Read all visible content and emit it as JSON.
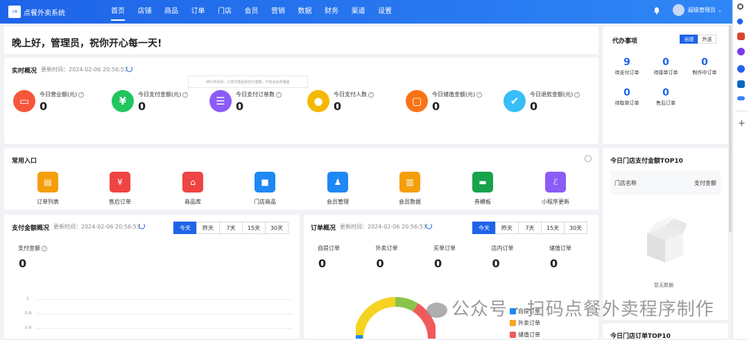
{
  "app": {
    "logo_mini": "点餐",
    "title": "点餐外卖系统"
  },
  "nav": [
    {
      "label": "首页",
      "active": true
    },
    {
      "label": "店铺"
    },
    {
      "label": "商品"
    },
    {
      "label": "订单"
    },
    {
      "label": "门店"
    },
    {
      "label": "会员"
    },
    {
      "label": "营销"
    },
    {
      "label": "数据"
    },
    {
      "label": "财务"
    },
    {
      "label": "渠道"
    },
    {
      "label": "设置"
    }
  ],
  "user": {
    "name": "超级管理员"
  },
  "greeting": "晚上好，管理员，祝你开心每一天!",
  "realtime": {
    "title": "实时概况",
    "updated": "更新时间：2024-02-06 20:56:53",
    "tooltip": "统计时间内，订单优惠后的实付金额，不包含会员储值",
    "stats": [
      {
        "label": "今日营业额(元)",
        "value": "0",
        "color": "#f5573b",
        "icon": "shop-icon",
        "glyph": "▭"
      },
      {
        "label": "今日支付金额(元)",
        "value": "0",
        "color": "#22c55e",
        "icon": "yen-icon",
        "glyph": "¥"
      },
      {
        "label": "今日支付订单数",
        "value": "0",
        "color": "#8b5cf6",
        "icon": "list-icon",
        "glyph": "☰"
      },
      {
        "label": "今日支付人数",
        "value": "0",
        "color": "#f5b800",
        "icon": "person-icon",
        "glyph": "●"
      },
      {
        "label": "今日储值金额(元)",
        "value": "0",
        "color": "#f97316",
        "icon": "wallet-icon",
        "glyph": "▢"
      },
      {
        "label": "今日退款金额(元)",
        "value": "0",
        "color": "#38bdf8",
        "icon": "shield-icon",
        "glyph": "✔"
      }
    ]
  },
  "entries": {
    "title": "常用入口",
    "items": [
      {
        "label": "订单列表",
        "color": "#f59e0b",
        "icon": "order-list-icon",
        "glyph": "▤"
      },
      {
        "label": "售后订单",
        "color": "#ef4444",
        "icon": "after-sale-icon",
        "glyph": "¥"
      },
      {
        "label": "商品库",
        "color": "#ef4444",
        "icon": "goods-bag-icon",
        "glyph": "⌂"
      },
      {
        "label": "门店商品",
        "color": "#1e88f5",
        "icon": "store-goods-icon",
        "glyph": "■"
      },
      {
        "label": "会员管理",
        "color": "#1e88f5",
        "icon": "member-icon",
        "glyph": "♟"
      },
      {
        "label": "会员数据",
        "color": "#f59e0b",
        "icon": "member-data-icon",
        "glyph": "▥"
      },
      {
        "label": "券模板",
        "color": "#16a34a",
        "icon": "coupon-icon",
        "glyph": "▬"
      },
      {
        "label": "小程序更新",
        "color": "#8b5cf6",
        "icon": "mini-program-icon",
        "glyph": "ℰ"
      }
    ]
  },
  "pay": {
    "title": "支付金额概况",
    "updated": "更新时间：2024-02-06 20:56:53",
    "tabs": [
      "今天",
      "昨天",
      "7天",
      "15天",
      "30天"
    ],
    "metric_label": "支付金额",
    "metric_value": "0",
    "yticks": [
      "1",
      "0.8",
      "0.6"
    ]
  },
  "orders": {
    "title": "订单概况",
    "updated": "更新时间：2024-02-06 20:56:53",
    "tabs": [
      "今天",
      "昨天",
      "7天",
      "15天",
      "30天"
    ],
    "metrics": [
      {
        "label": "自提订单",
        "value": "0"
      },
      {
        "label": "外卖订单",
        "value": "0"
      },
      {
        "label": "买单订单",
        "value": "0"
      },
      {
        "label": "店内订单",
        "value": "0"
      },
      {
        "label": "储值订单",
        "value": "0"
      }
    ],
    "legend": [
      {
        "label": "自提订单",
        "color": "#1e88f5"
      },
      {
        "label": "外卖订单",
        "color": "#f5a524"
      },
      {
        "label": "储值订单",
        "color": "#f05a5a"
      }
    ]
  },
  "todo": {
    "title": "代办事项",
    "toggle": [
      "自提",
      "外送"
    ],
    "items": [
      {
        "label": "待支付订单",
        "value": "9"
      },
      {
        "label": "待接单订单",
        "value": "0"
      },
      {
        "label": "制作中订单",
        "value": "0"
      },
      {
        "label": "待取单订单",
        "value": "0"
      },
      {
        "label": "售后订单",
        "value": "0"
      }
    ]
  },
  "top10pay": {
    "title": "今日门店支付金额TOP10",
    "col1": "门店名称",
    "col2": "支付金额",
    "empty": "暂无数据"
  },
  "top10order": {
    "title": "今日门店订单TOP10"
  },
  "watermark": "公众号 · 扫码点餐外卖程序制作"
}
